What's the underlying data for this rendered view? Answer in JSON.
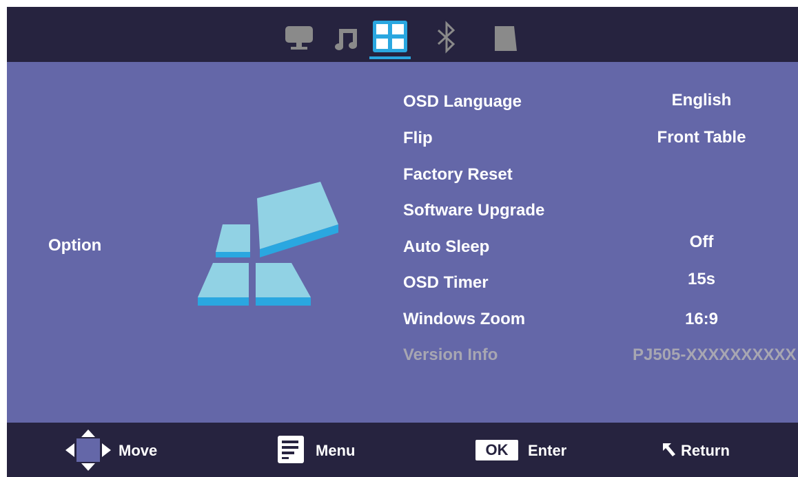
{
  "tabs": [
    {
      "name": "picture",
      "icon": "monitor-icon",
      "active": false
    },
    {
      "name": "sound",
      "icon": "music-note-icon",
      "active": false
    },
    {
      "name": "option",
      "icon": "grid-icon",
      "active": true
    },
    {
      "name": "bluetooth",
      "icon": "bluetooth-icon",
      "active": false
    },
    {
      "name": "keystone",
      "icon": "trapezoid-icon",
      "active": false
    }
  ],
  "section": {
    "title": "Option",
    "icon": "option-tiles-icon"
  },
  "menu": {
    "items": [
      {
        "label": "OSD Language",
        "value": "English",
        "enabled": true
      },
      {
        "label": "Flip",
        "value": "Front Table",
        "enabled": true
      },
      {
        "label": "Factory Reset",
        "value": "",
        "enabled": true
      },
      {
        "label": "Software Upgrade",
        "value": "",
        "enabled": true
      },
      {
        "label": "Auto Sleep",
        "value": "Off",
        "enabled": true
      },
      {
        "label": "OSD Timer",
        "value": "15s",
        "enabled": true
      },
      {
        "label": "Windows Zoom",
        "value": "16:9",
        "enabled": true
      },
      {
        "label": "Version Info",
        "value": "PJ505-XXXXXXXXXX",
        "enabled": false
      }
    ]
  },
  "hints": {
    "move": "Move",
    "menu": "Menu",
    "ok": "OK",
    "enter": "Enter",
    "return": "Return"
  },
  "colors": {
    "background": "#6467a8",
    "bars": "#26233f",
    "accent": "#2aa7e0",
    "disabled_text": "#a7a6b2"
  }
}
